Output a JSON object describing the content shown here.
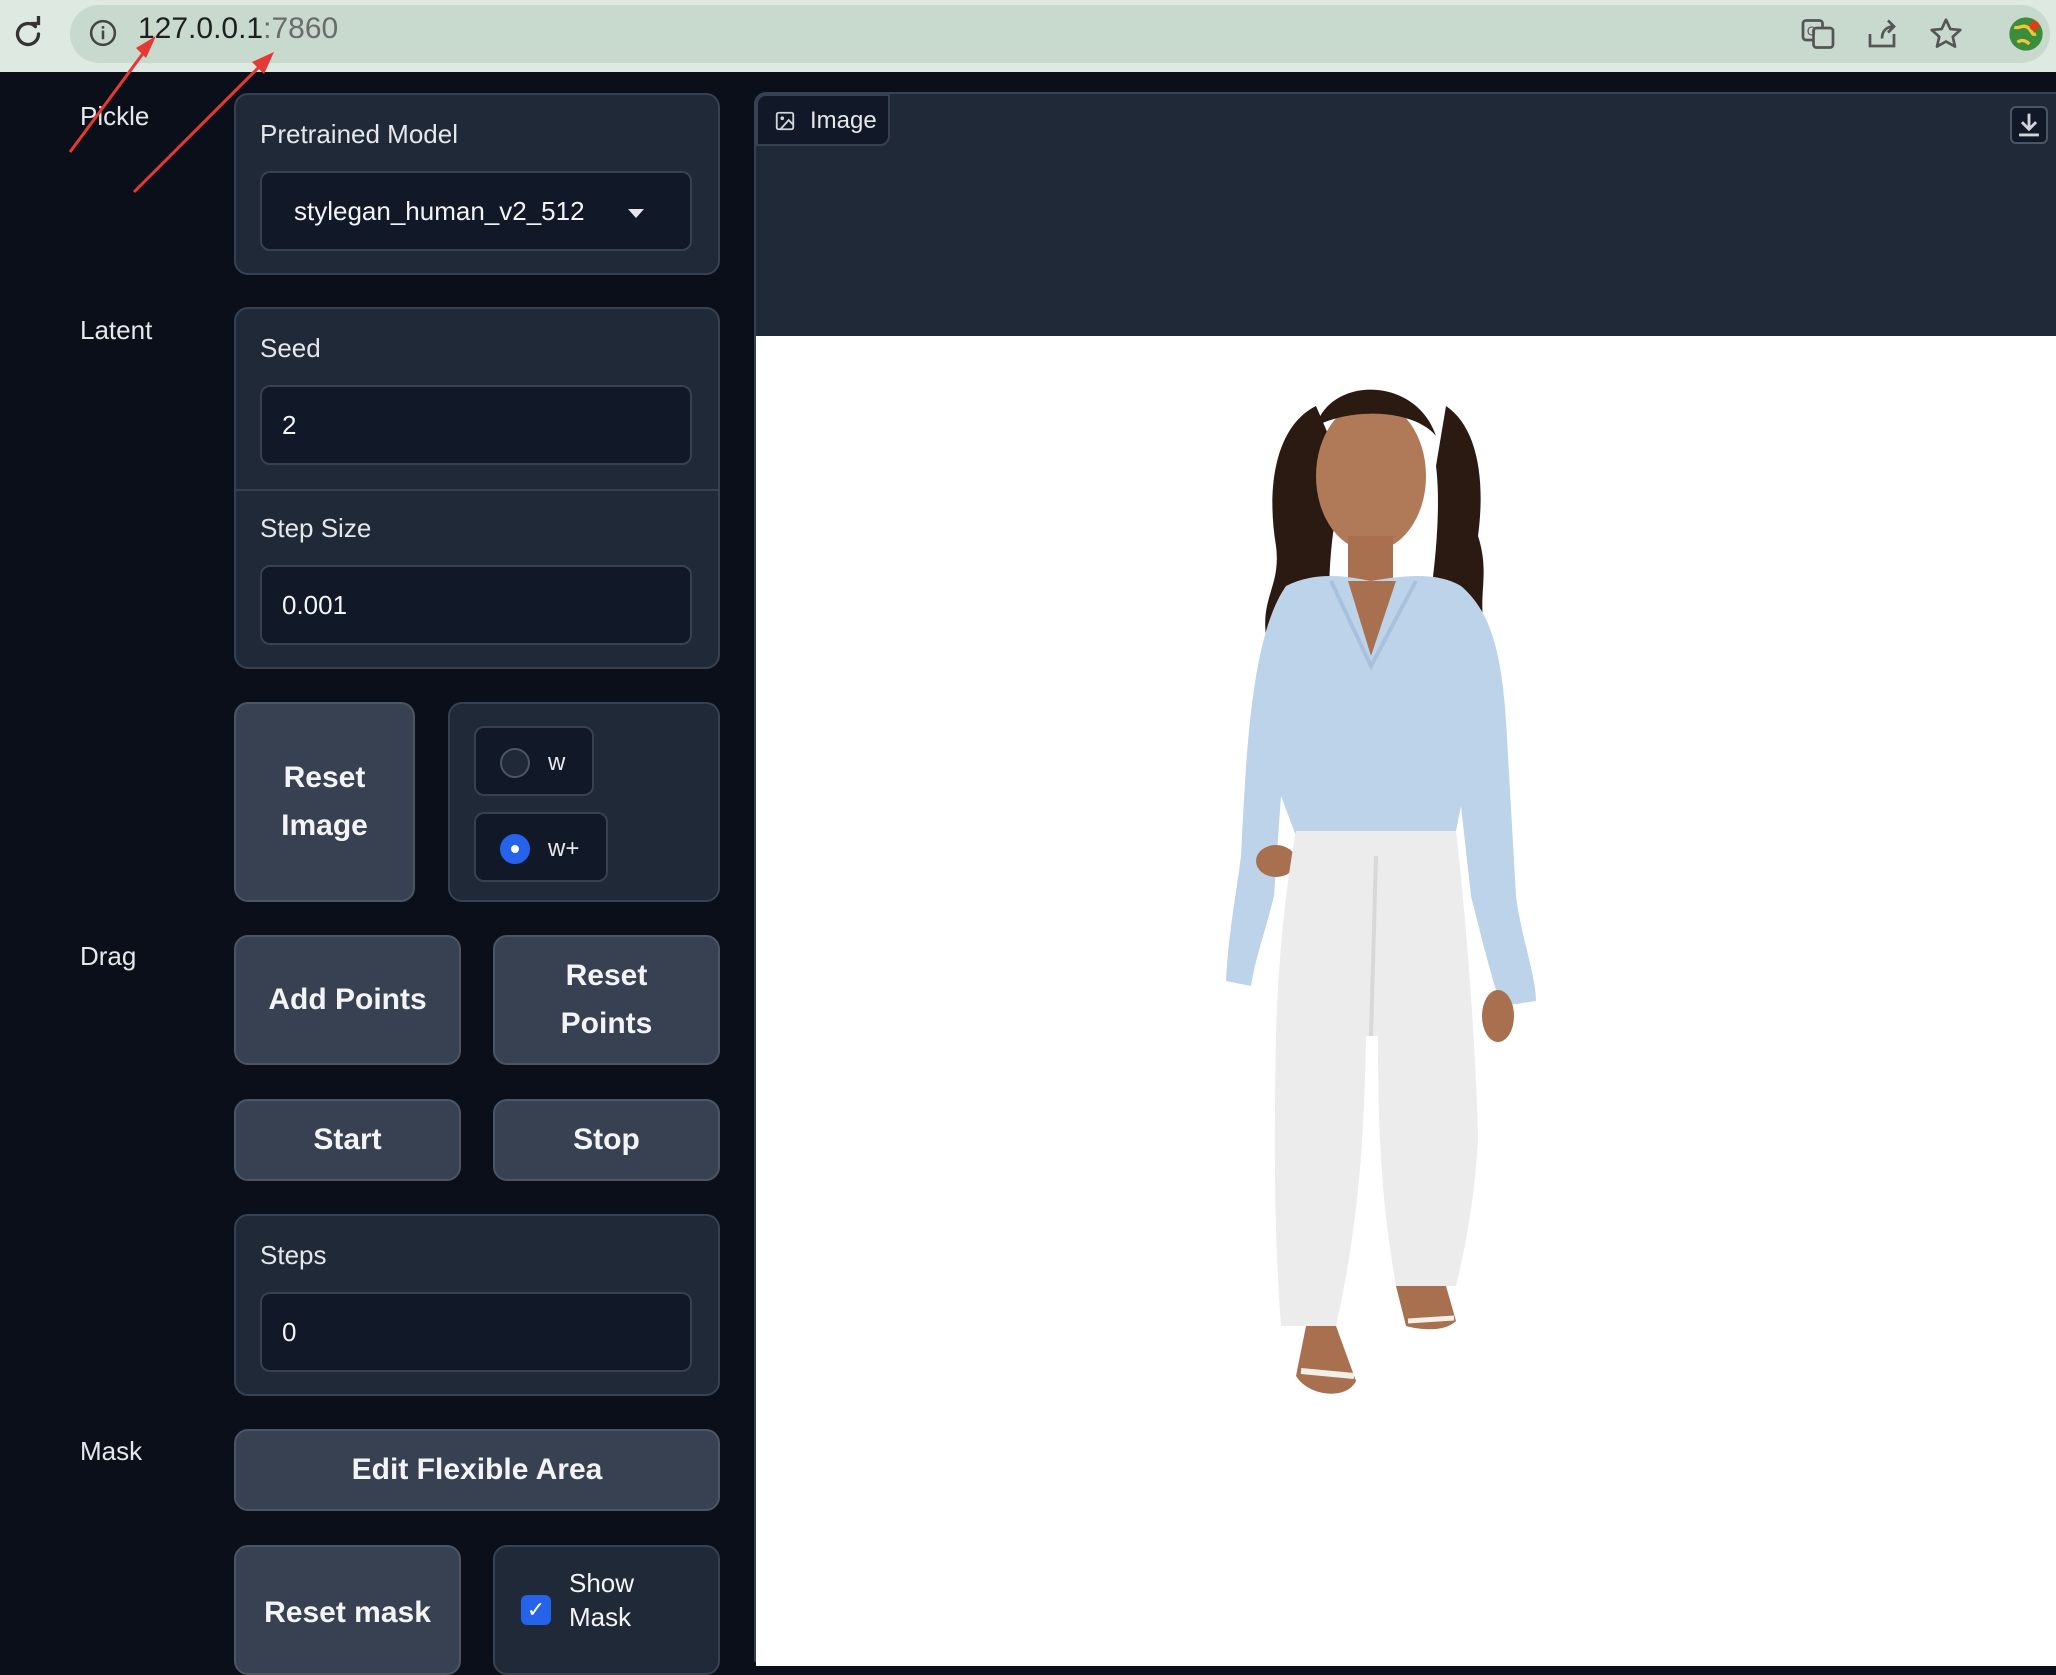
{
  "browser": {
    "url_host": "127.0.0.1",
    "url_port": ":7860",
    "icons": [
      "reload-icon",
      "info-icon",
      "translate-icon",
      "share-icon",
      "bookmark-star-icon",
      "extension-globe-icon"
    ]
  },
  "sections": {
    "pickle": "Pickle",
    "latent": "Latent",
    "drag": "Drag",
    "mask": "Mask"
  },
  "pickle": {
    "label": "Pretrained Model",
    "selected": "stylegan_human_v2_512"
  },
  "latent": {
    "seed_label": "Seed",
    "seed_value": "2",
    "step_size_label": "Step Size",
    "step_size_value": "0.001",
    "reset_image_label_line1": "Reset",
    "reset_image_label_line2": "Image",
    "latent_space_options": [
      {
        "label": "w",
        "selected": false
      },
      {
        "label": "w+",
        "selected": true
      }
    ]
  },
  "drag": {
    "add_points": "Add Points",
    "reset_points_line1": "Reset",
    "reset_points_line2": "Points",
    "start": "Start",
    "stop": "Stop",
    "steps_label": "Steps",
    "steps_value": "0"
  },
  "mask": {
    "edit_flexible_area": "Edit Flexible Area",
    "reset_mask": "Reset mask",
    "show_mask_line1": "Show",
    "show_mask_line2": "Mask",
    "show_mask_checked": true
  },
  "image_panel": {
    "tab_label": "Image"
  },
  "colors": {
    "page_bg": "#0b0f19",
    "block_bg": "#1f2937",
    "button_bg": "#374151",
    "accent": "#2563eb",
    "annotation_arrow": "#e53935"
  }
}
